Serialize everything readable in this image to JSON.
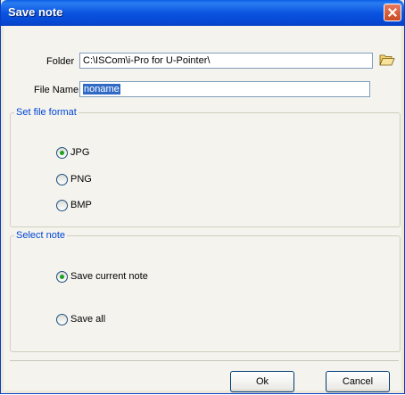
{
  "window": {
    "title": "Save note",
    "close_icon": "close-icon"
  },
  "folder": {
    "label": "Folder",
    "value": "C:\\ISCom\\i-Pro for U-Pointer\\",
    "browse_icon": "folder-open-icon"
  },
  "file_name": {
    "label": "File Name",
    "value": "noname"
  },
  "file_format": {
    "legend": "Set file format",
    "options": [
      "JPG",
      "PNG",
      "BMP"
    ],
    "selected": "JPG"
  },
  "select_note": {
    "legend": "Select note",
    "options": [
      "Save current note",
      "Save all"
    ],
    "selected": "Save current note"
  },
  "buttons": {
    "ok": "Ok",
    "cancel": "Cancel"
  },
  "colors": {
    "title_bar": "#0b54e0",
    "legend_text": "#0046d5",
    "selected_radio": "#21a121"
  }
}
